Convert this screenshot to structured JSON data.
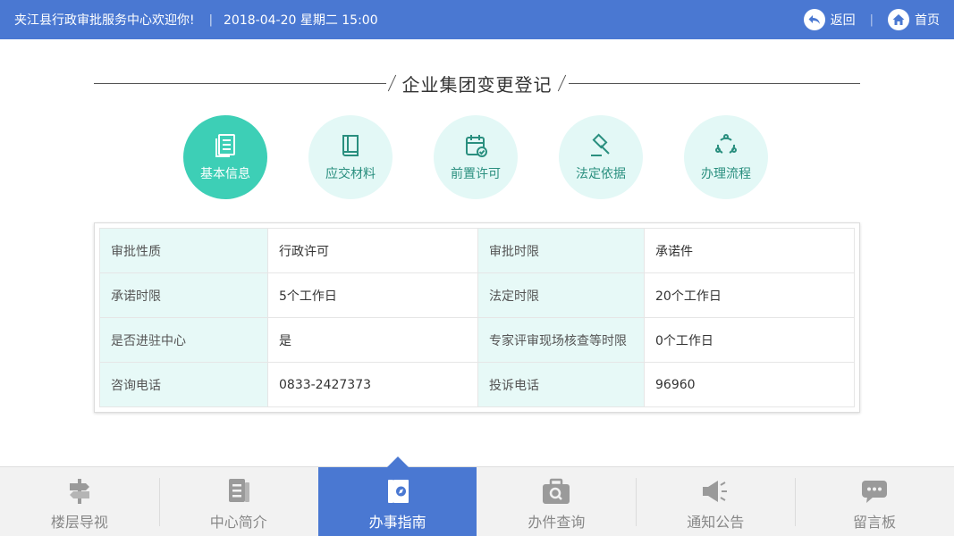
{
  "header": {
    "welcome": "夹江县行政审批服务中心欢迎你!",
    "separator": "|",
    "datetime": "2018-04-20  星期二  15:00",
    "back_label": "返回",
    "home_label": "首页",
    "accent_color": "#4a78d2"
  },
  "page": {
    "title": "企业集团变更登记"
  },
  "tabs": [
    {
      "label": "基本信息",
      "icon": "document-list-icon",
      "active": true
    },
    {
      "label": "应交材料",
      "icon": "book-icon",
      "active": false
    },
    {
      "label": "前置许可",
      "icon": "calendar-check-icon",
      "active": false
    },
    {
      "label": "法定依据",
      "icon": "gavel-icon",
      "active": false
    },
    {
      "label": "办理流程",
      "icon": "process-cycle-icon",
      "active": false
    }
  ],
  "info_table": {
    "rows": [
      {
        "k1": "审批性质",
        "v1": "行政许可",
        "k2": "审批时限",
        "v2": "承诺件"
      },
      {
        "k1": "承诺时限",
        "v1": "5个工作日",
        "k2": "法定时限",
        "v2": "20个工作日"
      },
      {
        "k1": "是否进驻中心",
        "v1": "是",
        "k2": "专家评审现场核查等时限",
        "v2": "0个工作日"
      },
      {
        "k1": "咨询电话",
        "v1": "0833-2427373",
        "k2": "投诉电话",
        "v2": "96960"
      }
    ]
  },
  "bottom_nav": [
    {
      "label": "楼层导视",
      "icon": "signpost-icon",
      "active": false
    },
    {
      "label": "中心简介",
      "icon": "document-icon",
      "active": false
    },
    {
      "label": "办事指南",
      "icon": "guide-book-icon",
      "active": true
    },
    {
      "label": "办件查询",
      "icon": "search-case-icon",
      "active": false
    },
    {
      "label": "通知公告",
      "icon": "megaphone-icon",
      "active": false
    },
    {
      "label": "留言板",
      "icon": "chat-bubble-icon",
      "active": false
    }
  ],
  "colors": {
    "teal_active": "#3dcfb6",
    "teal_light": "#e3f8f6",
    "table_key_bg": "#e7f9f7"
  }
}
